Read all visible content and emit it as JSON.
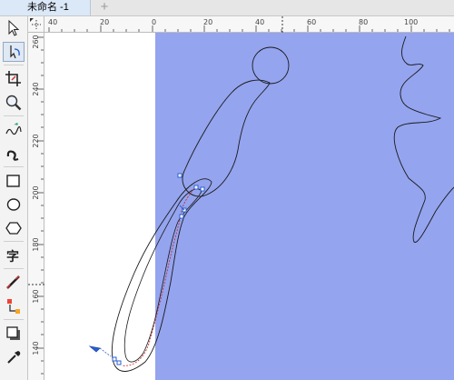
{
  "document": {
    "tab_title": "未命名 -1",
    "new_tab_symbol": "+"
  },
  "toolbox": {
    "tools": [
      {
        "name": "pick-tool",
        "icon": "arrow-icon"
      },
      {
        "name": "shape-tool",
        "icon": "node-edit-icon"
      },
      {
        "name": "crop-tool",
        "icon": "crop-icon"
      },
      {
        "name": "zoom-tool",
        "icon": "magnifier-icon"
      },
      {
        "name": "freehand-tool",
        "icon": "freehand-icon"
      },
      {
        "name": "artistic-media-tool",
        "icon": "brush-curve-icon"
      },
      {
        "name": "rectangle-tool",
        "icon": "rectangle-icon"
      },
      {
        "name": "ellipse-tool",
        "icon": "ellipse-icon"
      },
      {
        "name": "polygon-tool",
        "icon": "polygon-icon"
      },
      {
        "name": "text-tool",
        "icon": "text-icon",
        "glyph": "字"
      },
      {
        "name": "parallel-dimension-tool",
        "icon": "dimension-icon"
      },
      {
        "name": "interactive-fill-tool",
        "icon": "fill-icon"
      },
      {
        "name": "drop-shadow-tool",
        "icon": "shadow-icon"
      },
      {
        "name": "eyedropper-tool",
        "icon": "eyedropper-icon"
      }
    ]
  },
  "rulers": {
    "horizontal_labels": [
      "40",
      "20",
      "0",
      "20",
      "40",
      "60",
      "80",
      "100"
    ],
    "vertical_labels": [
      "260",
      "240",
      "220",
      "200",
      "180",
      "160",
      "140"
    ]
  },
  "canvas": {
    "page_fill": "#ffffff",
    "rectangle_fill": "#94a4ef",
    "stroke_color": "#1a1a1a",
    "node_color": "#2a5fd1",
    "highlight_color": "#cc2222"
  }
}
